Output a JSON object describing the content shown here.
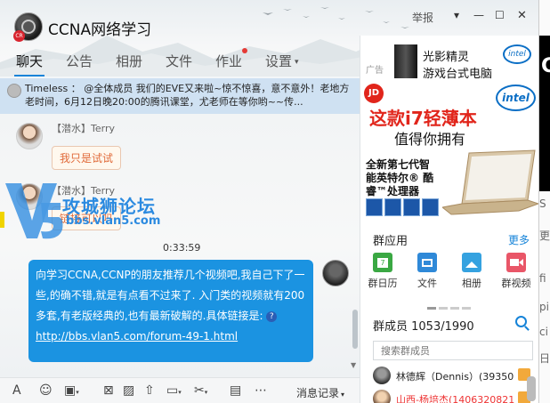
{
  "window": {
    "title": "CCNA网络学习",
    "report": "举报",
    "avatar_badge": "CR"
  },
  "tabs": [
    {
      "label": "聊天",
      "active": true
    },
    {
      "label": "公告"
    },
    {
      "label": "相册"
    },
    {
      "label": "文件"
    },
    {
      "label": "作业"
    },
    {
      "label": "设置"
    }
  ],
  "notice": {
    "text": "Timeless ： @全体成员 我们的EVE又来啦~惊不惊喜，意不意外！老地方老时间，6月12日晚20:00的腾讯课堂，尤老师在等你哟~~传..."
  },
  "messages": {
    "m1_sender": "【潜水】Terry",
    "m1_text": "我只是试试",
    "m2_sender": "【潜水】Terry",
    "m2_text": "链接可以吗",
    "time": "0:33:59",
    "m3_text": "向学习CCNA,CCNP的朋友推荐几个视频吧,我自己下了一些,的确不错,就是有点看不过来了. 入门类的视频就有200多套,有老版经典的,也有最新破解的.具体链接是: ",
    "m3_link": "http://bbs.vlan5.com/forum-49-1.html"
  },
  "watermark": {
    "line1": "攻城狮论坛",
    "line2": "bbs.vlan5.com"
  },
  "toolbar": {
    "history": "消息记录"
  },
  "ad": {
    "label": "广告",
    "line1a": "光影精灵",
    "line1b": "游戏台式电脑",
    "jd": "JD",
    "intel": "intel",
    "line2": "这款i7轻薄本",
    "line3": "值得你拥有",
    "line4": "全新第七代智能英特尔® 酷睿™处理器"
  },
  "apps": {
    "heading": "群应用",
    "more": "更多",
    "items": [
      {
        "label": "群日历",
        "color": "#3aa843"
      },
      {
        "label": "文件",
        "color": "#2f89d8"
      },
      {
        "label": "相册",
        "color": "#35a2e0"
      },
      {
        "label": "群视频",
        "color": "#e95668"
      }
    ]
  },
  "members": {
    "heading": "群成员 1053/1990",
    "search_placeholder": "搜索群成员",
    "list": [
      {
        "name": "林德辉（Dennis）(39350",
        "red": false
      },
      {
        "name": "山西-杨培杰(1406320821",
        "red": true
      }
    ]
  },
  "edge": {
    "top_char": "C",
    "chars": [
      "S",
      "更",
      "fi",
      "pi",
      "ci",
      "日"
    ]
  }
}
